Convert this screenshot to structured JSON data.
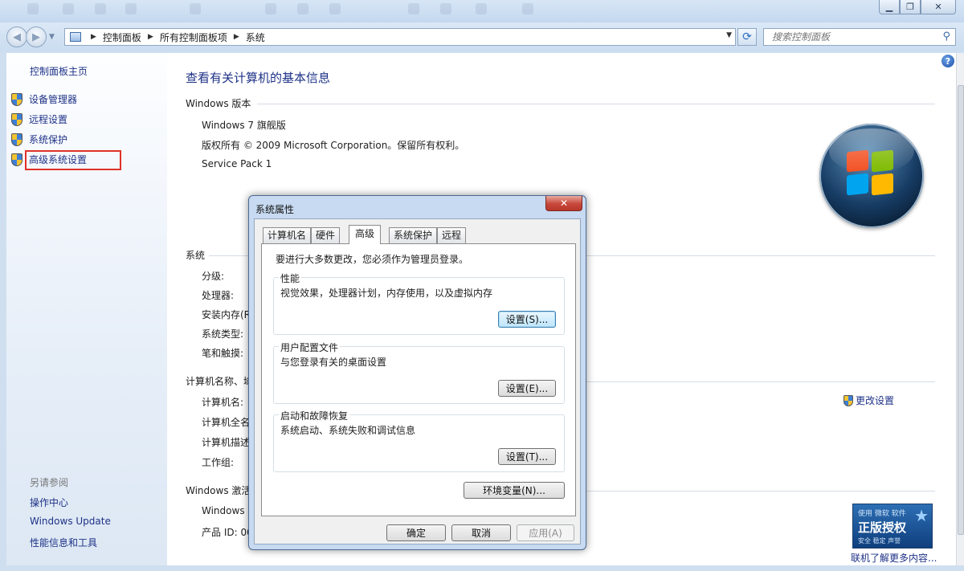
{
  "address": {
    "crumbs": [
      "控制面板",
      "所有控制面板项",
      "系统"
    ],
    "search_placeholder": "搜索控制面板"
  },
  "left_pane": {
    "home": "控制面板主页",
    "tasks": [
      "设备管理器",
      "远程设置",
      "系统保护",
      "高级系统设置"
    ],
    "see_also_header": "另请参阅",
    "see_also": [
      "操作中心",
      "Windows Update",
      "性能信息和工具"
    ]
  },
  "main": {
    "title": "查看有关计算机的基本信息",
    "edition_header": "Windows 版本",
    "edition": "Windows 7 旗舰版",
    "copyright": "版权所有 © 2009 Microsoft Corporation。保留所有权利。",
    "service_pack": "Service Pack 1",
    "system_header": "系统",
    "system_labels": [
      "分级:",
      "处理器:",
      "安装内存(R",
      "系统类型:",
      "笔和触摸:"
    ],
    "computer_header": "计算机名称、域",
    "computer_labels": [
      "计算机名:",
      "计算机全名",
      "计算机描述",
      "工作组:"
    ],
    "change_settings": "更改设置",
    "activation_header": "Windows 激活",
    "activation_labels": [
      "Windows",
      "产品 ID: 00"
    ],
    "genuine_line1": "使用 微软 软件",
    "genuine_line2": "正版授权",
    "genuine_line3": "安全  稳定  声誉",
    "genuine_link": "联机了解更多内容..."
  },
  "dialog": {
    "title": "系统属性",
    "close_glyph": "✕",
    "tabs": [
      "计算机名",
      "硬件",
      "高级",
      "系统保护",
      "远程"
    ],
    "active_tab": "高级",
    "admin_note": "要进行大多数更改，您必须作为管理员登录。",
    "performance": {
      "label": "性能",
      "desc": "视觉效果，处理器计划，内存使用，以及虚拟内存",
      "button": "设置(S)..."
    },
    "user_profiles": {
      "label": "用户配置文件",
      "desc": "与您登录有关的桌面设置",
      "button": "设置(E)..."
    },
    "startup_recovery": {
      "label": "启动和故障恢复",
      "desc": "系统启动、系统失败和调试信息",
      "button": "设置(T)..."
    },
    "env_button": "环境变量(N)...",
    "ok": "确定",
    "cancel": "取消",
    "apply": "应用(A)"
  },
  "colors": {
    "link": "#1e3287",
    "highlight_box": "#e0312a",
    "panel_bg": "#e6eef8"
  },
  "icons": {
    "shield": "uac-shield-icon",
    "help": "help-icon",
    "search": "search-icon"
  }
}
